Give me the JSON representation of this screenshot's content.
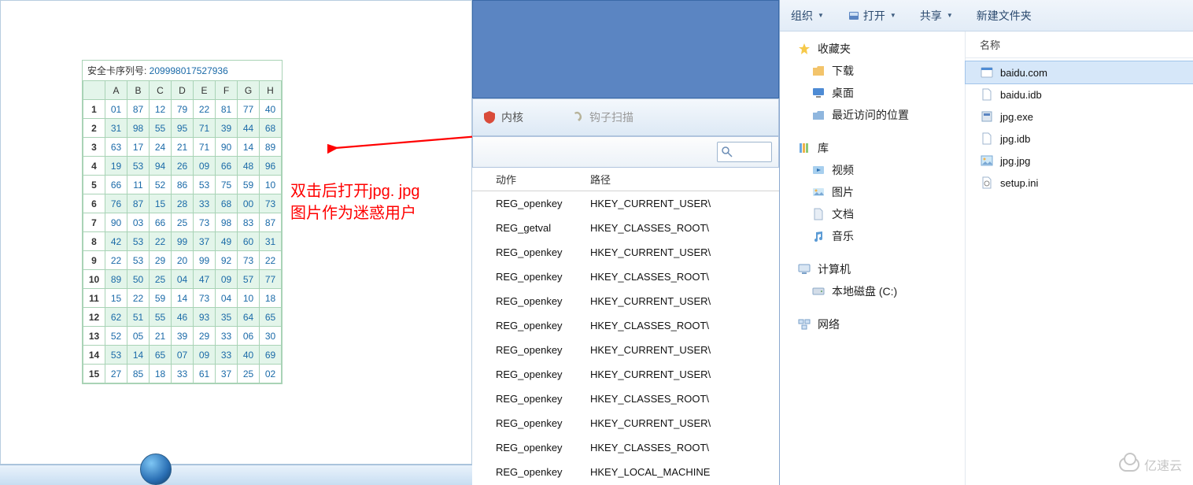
{
  "security_card": {
    "title_prefix": "安全卡序列号: ",
    "serial": "209998017527936",
    "columns": [
      "A",
      "B",
      "C",
      "D",
      "E",
      "F",
      "G",
      "H"
    ],
    "rows": [
      {
        "n": 1,
        "v": [
          "01",
          "87",
          "12",
          "79",
          "22",
          "81",
          "77",
          "40"
        ],
        "hi": []
      },
      {
        "n": 2,
        "v": [
          "31",
          "98",
          "55",
          "95",
          "71",
          "39",
          "44",
          "68"
        ],
        "hi": [
          0,
          1,
          2,
          3,
          4,
          5,
          6,
          7
        ]
      },
      {
        "n": 3,
        "v": [
          "63",
          "17",
          "24",
          "21",
          "71",
          "90",
          "14",
          "89"
        ],
        "hi": []
      },
      {
        "n": 4,
        "v": [
          "19",
          "53",
          "94",
          "26",
          "09",
          "66",
          "48",
          "96"
        ],
        "hi": [
          0,
          1,
          2,
          3,
          4,
          5,
          6,
          7
        ]
      },
      {
        "n": 5,
        "v": [
          "66",
          "11",
          "52",
          "86",
          "53",
          "75",
          "59",
          "10"
        ],
        "hi": []
      },
      {
        "n": 6,
        "v": [
          "76",
          "87",
          "15",
          "28",
          "33",
          "68",
          "00",
          "73"
        ],
        "hi": [
          0,
          1,
          2,
          3,
          4,
          5,
          6,
          7
        ]
      },
      {
        "n": 7,
        "v": [
          "90",
          "03",
          "66",
          "25",
          "73",
          "98",
          "83",
          "87"
        ],
        "hi": []
      },
      {
        "n": 8,
        "v": [
          "42",
          "53",
          "22",
          "99",
          "37",
          "49",
          "60",
          "31"
        ],
        "hi": [
          0,
          1,
          2,
          3,
          4,
          5,
          6,
          7
        ]
      },
      {
        "n": 9,
        "v": [
          "22",
          "53",
          "29",
          "20",
          "99",
          "92",
          "73",
          "22"
        ],
        "hi": []
      },
      {
        "n": 10,
        "v": [
          "89",
          "50",
          "25",
          "04",
          "47",
          "09",
          "57",
          "77"
        ],
        "hi": [
          0,
          1,
          2,
          3,
          4,
          5,
          6,
          7
        ]
      },
      {
        "n": 11,
        "v": [
          "15",
          "22",
          "59",
          "14",
          "73",
          "04",
          "10",
          "18"
        ],
        "hi": []
      },
      {
        "n": 12,
        "v": [
          "62",
          "51",
          "55",
          "46",
          "93",
          "35",
          "64",
          "65"
        ],
        "hi": [
          0,
          1,
          2,
          3,
          4,
          5,
          6,
          7
        ]
      },
      {
        "n": 13,
        "v": [
          "52",
          "05",
          "21",
          "39",
          "29",
          "33",
          "06",
          "30"
        ],
        "hi": []
      },
      {
        "n": 14,
        "v": [
          "53",
          "14",
          "65",
          "07",
          "09",
          "33",
          "40",
          "69"
        ],
        "hi": [
          0,
          1,
          2,
          3,
          4,
          5,
          6,
          7
        ]
      },
      {
        "n": 15,
        "v": [
          "27",
          "85",
          "18",
          "33",
          "61",
          "37",
          "25",
          "02"
        ],
        "hi": []
      }
    ]
  },
  "annotation": {
    "line1": "双击后打开jpg. jpg",
    "line2": "图片作为迷惑用户"
  },
  "mid_panel": {
    "tab_kernel": "内核",
    "tab_hook": "钩子扫描",
    "col_action": "动作",
    "col_path": "路径",
    "rows": [
      {
        "a": "REG_openkey",
        "p": "HKEY_CURRENT_USER\\"
      },
      {
        "a": "REG_getval",
        "p": "HKEY_CLASSES_ROOT\\"
      },
      {
        "a": "REG_openkey",
        "p": "HKEY_CURRENT_USER\\"
      },
      {
        "a": "REG_openkey",
        "p": "HKEY_CLASSES_ROOT\\"
      },
      {
        "a": "REG_openkey",
        "p": "HKEY_CURRENT_USER\\"
      },
      {
        "a": "REG_openkey",
        "p": "HKEY_CLASSES_ROOT\\"
      },
      {
        "a": "REG_openkey",
        "p": "HKEY_CURRENT_USER\\"
      },
      {
        "a": "REG_openkey",
        "p": "HKEY_CURRENT_USER\\"
      },
      {
        "a": "REG_openkey",
        "p": "HKEY_CLASSES_ROOT\\"
      },
      {
        "a": "REG_openkey",
        "p": "HKEY_CURRENT_USER\\"
      },
      {
        "a": "REG_openkey",
        "p": "HKEY_CLASSES_ROOT\\"
      },
      {
        "a": "REG_openkey",
        "p": "HKEY_LOCAL_MACHINE"
      }
    ]
  },
  "explorer": {
    "toolbar": {
      "organize": "组织",
      "open": "打开",
      "share": "共享",
      "newfolder": "新建文件夹"
    },
    "nav": {
      "favorites": "收藏夹",
      "downloads": "下载",
      "desktop": "桌面",
      "recent": "最近访问的位置",
      "libraries": "库",
      "videos": "视频",
      "pictures": "图片",
      "documents": "文档",
      "music": "音乐",
      "computer": "计算机",
      "localdisk": "本地磁盘 (C:)",
      "network": "网络"
    },
    "col_name": "名称",
    "files": [
      {
        "name": "baidu.com",
        "icon": "app",
        "sel": true
      },
      {
        "name": "baidu.idb",
        "icon": "file",
        "sel": false
      },
      {
        "name": "jpg.exe",
        "icon": "exe",
        "sel": false
      },
      {
        "name": "jpg.idb",
        "icon": "file",
        "sel": false
      },
      {
        "name": "jpg.jpg",
        "icon": "img",
        "sel": false
      },
      {
        "name": "setup.ini",
        "icon": "ini",
        "sel": false
      }
    ]
  },
  "watermark": "亿速云"
}
